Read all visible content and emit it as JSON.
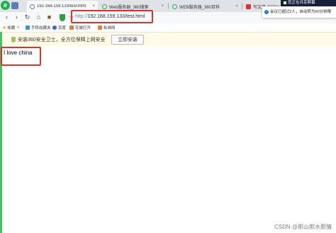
{
  "tabs": [
    {
      "label": "192.168.159.133/test.html",
      "favicon": "globe-icon",
      "color": "#5b7fb8"
    },
    {
      "label": "Web服务器_360搜索",
      "favicon": "360-search-icon",
      "color": "#2ab34b"
    },
    {
      "label": "WEB服务器_360百科",
      "favicon": "360-search-icon",
      "color": "#2ab34b"
    },
    {
      "label": "写文章-CSDN创作中",
      "favicon": "csdn-icon",
      "color": "#e0322c"
    }
  ],
  "tab_close": "×",
  "address": {
    "protocol": "http://",
    "host_path": "192.168.159.133/test.html"
  },
  "bookmarks": [
    {
      "label": "收藏",
      "icon": "star-icon",
      "color": "#f3a626"
    },
    {
      "label": "手机收藏夹",
      "icon": "phone-icon",
      "color": "#3d8fd8"
    },
    {
      "label": "百度",
      "icon": "baidu-icon",
      "color": "#3a62d6"
    },
    {
      "label": "花城打开",
      "icon": "bookmark-icon",
      "color": "#e07b39"
    },
    {
      "label": "标准网",
      "icon": "bookmark-icon",
      "color": "#e07b39"
    }
  ],
  "infobar": {
    "text": "安装360安全卫士，全方位保障上网安全",
    "button": "立即安装"
  },
  "page": {
    "text": "I love china"
  },
  "notification": {
    "header": "您正在共享屏幕",
    "body": "会议已超过2人，自动转为60分钟限"
  },
  "watermark": "CSDN @那山那水那情",
  "colors": {
    "accent": "#2ab34b",
    "highlight": "#e0322c",
    "notice": "#fffbe6"
  }
}
